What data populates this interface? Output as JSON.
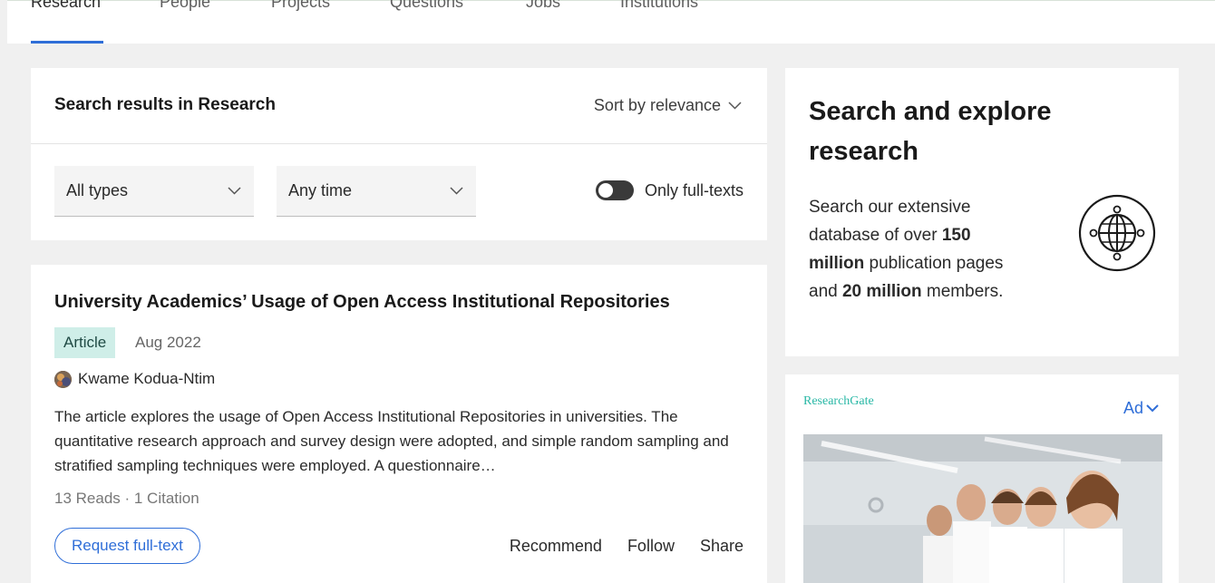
{
  "tabs": [
    {
      "label": "Research",
      "active": true
    },
    {
      "label": "People"
    },
    {
      "label": "Projects"
    },
    {
      "label": "Questions"
    },
    {
      "label": "Jobs"
    },
    {
      "label": "Institutions"
    }
  ],
  "search": {
    "title": "Search results in Research",
    "sort_label": "Sort by relevance",
    "type_filter": "All types",
    "time_filter": "Any time",
    "fulltext_toggle_label": "Only full-texts",
    "fulltext_toggle_on": false
  },
  "result": {
    "title": "University Academics’ Usage of Open Access Institutional Repositories",
    "type_badge": "Article",
    "date": "Aug 2022",
    "author": "Kwame Kodua-Ntim",
    "abstract": "The article explores the usage of Open Access Institutional Repositories in universities. The quantitative research approach and survey design were adopted, and simple random sampling and stratified sampling techniques were employed. A questionnaire…",
    "stats": "13 Reads · 1 Citation",
    "request_button": "Request full-text",
    "actions": {
      "recommend": "Recommend",
      "follow": "Follow",
      "share": "Share"
    }
  },
  "explore": {
    "title": "Search and explore research",
    "text_1": "Search our extensive database of over ",
    "bold_1": "150 million",
    "text_2": " publication pages and ",
    "bold_2": "20 million",
    "text_3": " members.",
    "icon": "globe-network-icon"
  },
  "ad": {
    "brand": "ResearchGate",
    "label": "Ad"
  },
  "colors": {
    "accent": "#2f6ed8",
    "badge_bg": "#cfeee8",
    "brand_teal": "#2ab8a6",
    "page_bg": "#f0f0f0"
  }
}
